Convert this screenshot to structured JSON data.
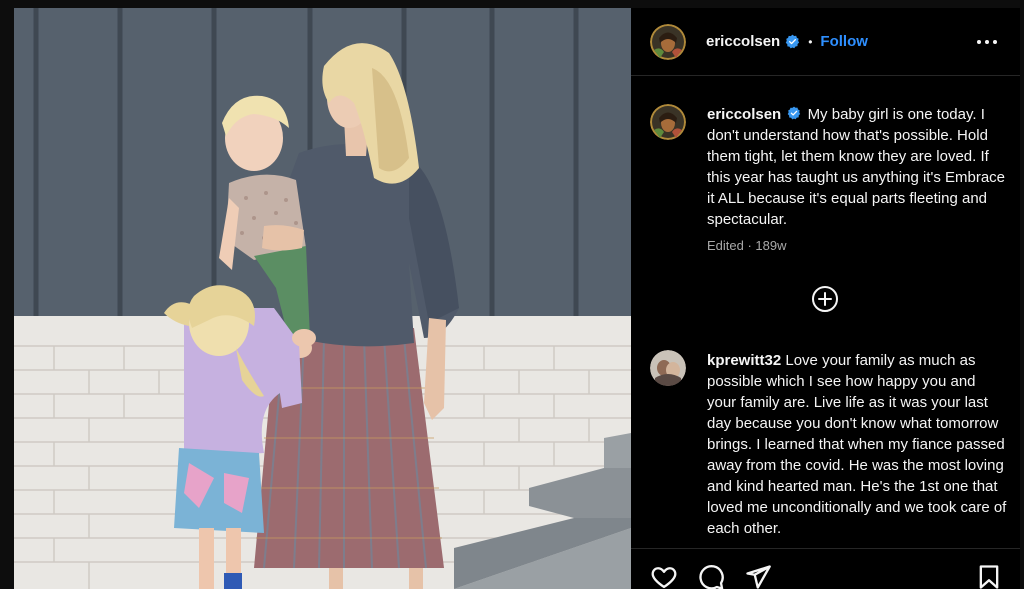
{
  "post": {
    "author": "ericcolsen",
    "follow_label": "Follow",
    "separator": "•",
    "photo_alt": "Woman with blonde hair holding a toddler beside a young child, standing in front of a white brick wall and grey siding"
  },
  "caption": {
    "user": "ericcolsen",
    "text": "My baby girl is one today. I don't understand how that's possible. Hold them tight, let them know they are loved. If this year has taught us anything it's Embrace it ALL because it's equal parts fleeting and spectacular.",
    "meta": "Edited · 189w"
  },
  "comments": [
    {
      "user": "kprewitt32",
      "text": "Love your family as much as possible which I see how happy you and your family are. Live life as it was your last day because you don't know what tomorrow brings. I learned that when my fiance passed away from the covid. He was the most loving and kind hearted man. He's the 1st one that loved me unconditionally and we took care of each other."
    }
  ],
  "icons": {
    "verified": "verified-badge-icon",
    "more": "more-options-icon",
    "load_more": "plus-circle-icon",
    "like": "heart-icon",
    "comment": "comment-bubble-icon",
    "share": "paper-plane-icon",
    "save": "bookmark-icon"
  },
  "colors": {
    "accent": "#0095f6",
    "panel_bg": "#000000",
    "text": "#f5f5f5",
    "muted": "#a8a8a8"
  }
}
